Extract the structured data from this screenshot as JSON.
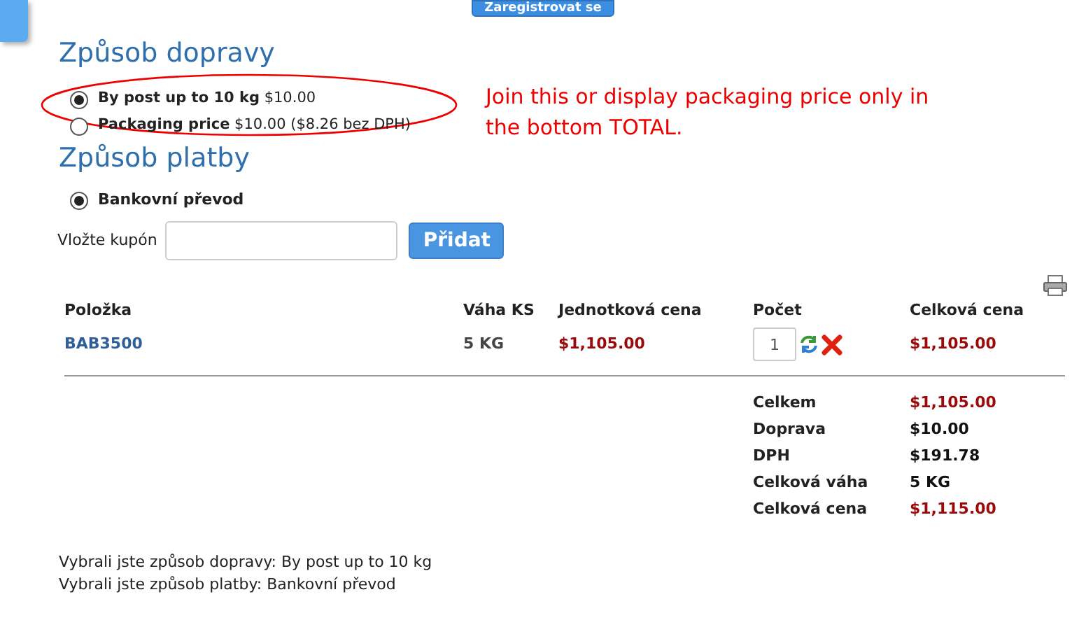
{
  "register_button": {
    "label": "Zaregistrovat se"
  },
  "shipping": {
    "title": "Způsob dopravy",
    "options": [
      {
        "name": "By post up to 10 kg",
        "price": "$10.00",
        "selected": true
      },
      {
        "name": "Packaging price",
        "price": "$10.00",
        "note": "($8.26 bez DPH)",
        "selected": false
      }
    ]
  },
  "annotation": {
    "text": "Join this or display packaging price only in the bottom TOTAL."
  },
  "payment": {
    "title": "Způsob platby",
    "options": [
      {
        "name": "Bankovní převod",
        "selected": true
      }
    ]
  },
  "coupon": {
    "label": "Vložte kupón",
    "button": "Přidat"
  },
  "table": {
    "columns": [
      "Položka",
      "Váha KS",
      "Jednotková cena",
      "Počet",
      "Celková cena"
    ],
    "rows": [
      {
        "item": "BAB3500",
        "weight": "5 KG",
        "unit_price": "$1,105.00",
        "quantity": "1",
        "total": "$1,105.00"
      }
    ]
  },
  "summary": [
    {
      "label": "Celkem",
      "value": "$1,105.00",
      "highlight": true
    },
    {
      "label": "Doprava",
      "value": "$10.00",
      "highlight": false
    },
    {
      "label": "DPH",
      "value": "$191.78",
      "highlight": false
    },
    {
      "label": "Celková váha",
      "value": "5 KG",
      "highlight": false
    },
    {
      "label": "Celková cena",
      "value": "$1,115.00",
      "highlight": true
    }
  ],
  "footer": [
    "Vybrali jste způsob dopravy: By post up to 10 kg",
    "Vybrali jste způsob platby: Bankovní převod"
  ]
}
